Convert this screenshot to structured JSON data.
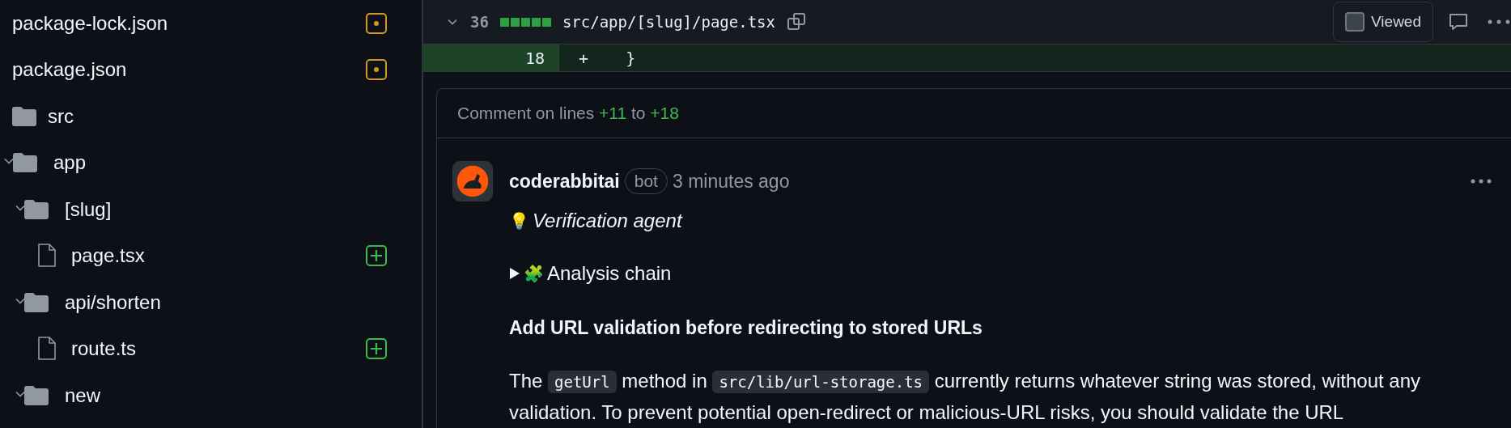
{
  "file_tree": [
    {
      "name": "package-lock.json",
      "kind": "modified-file"
    },
    {
      "name": "package.json",
      "kind": "modified-file"
    },
    {
      "name": "src",
      "kind": "folder",
      "children": [
        {
          "name": "app",
          "kind": "folder",
          "expanded": true,
          "children": [
            {
              "name": "[slug]",
              "kind": "folder",
              "expanded": true,
              "children": [
                {
                  "name": "page.tsx",
                  "kind": "added-file"
                }
              ]
            },
            {
              "name": "api/shorten",
              "kind": "folder",
              "expanded": true,
              "children": [
                {
                  "name": "route.ts",
                  "kind": "added-file"
                }
              ]
            },
            {
              "name": "new",
              "kind": "folder",
              "expanded": true
            }
          ]
        }
      ]
    }
  ],
  "diff_file": {
    "expanded": true,
    "changes": "36",
    "path": "src/app/[slug]/page.tsx",
    "viewed": false,
    "viewed_label": "Viewed"
  },
  "diff_lines": [
    {
      "kind": "added",
      "line_number": "18",
      "sign": "+",
      "code": "  }"
    }
  ],
  "comment_thread": {
    "header_parts": [
      {
        "kind": "text",
        "text": "Comment on lines "
      },
      {
        "kind": "line",
        "text": "+11"
      },
      {
        "kind": "text",
        "text": " to "
      },
      {
        "kind": "line",
        "text": "+18"
      }
    ],
    "comment": {
      "author": "coderabbitai",
      "badge": "bot",
      "time": "3 minutes ago",
      "agent_note": "Verification agent",
      "agent_emoji": "💡",
      "chain_label": "Analysis chain",
      "chain_emoji": "🧩",
      "chain_expanded": false,
      "heading": "Add URL validation before redirecting to stored URLs",
      "paragraph": [
        {
          "kind": "text",
          "text": "The "
        },
        {
          "kind": "code",
          "text": "getUrl"
        },
        {
          "kind": "text",
          "text": " method in "
        },
        {
          "kind": "code",
          "text": "src/lib/url-storage.ts"
        },
        {
          "kind": "text",
          "text": " currently returns whatever string was stored, without any validation. To prevent potential open-redirect or malicious-URL risks, you should validate the URL"
        }
      ]
    }
  }
}
